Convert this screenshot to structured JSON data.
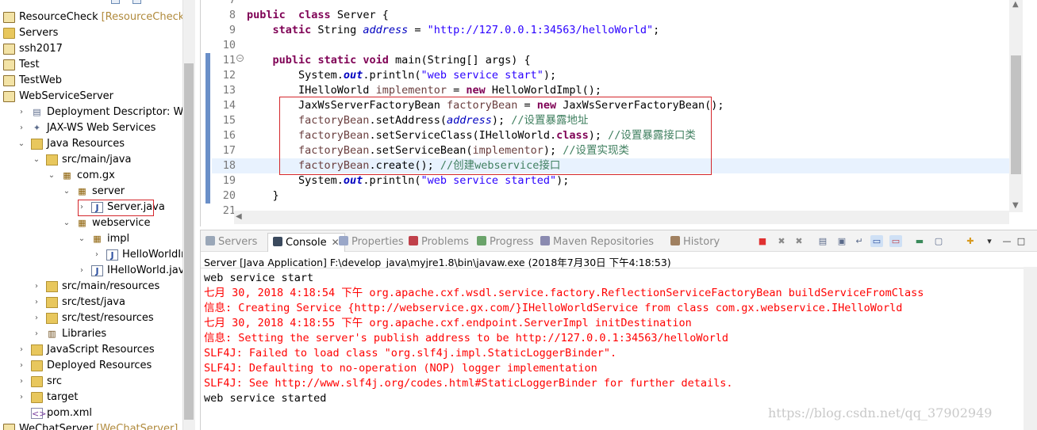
{
  "explorer": {
    "items": [
      {
        "label": "ResourceCheck",
        "deco": "[ResourceCheck]",
        "icon": "project-icon",
        "arrow": "",
        "level": 0
      },
      {
        "label": "Servers",
        "deco": "",
        "icon": "folder-icon",
        "arrow": "",
        "level": 0
      },
      {
        "label": "ssh2017",
        "deco": "",
        "icon": "project-icon",
        "arrow": "",
        "level": 0
      },
      {
        "label": "Test",
        "deco": "",
        "icon": "project-icon",
        "arrow": "",
        "level": 0
      },
      {
        "label": "TestWeb",
        "deco": "",
        "icon": "project-icon",
        "arrow": "",
        "level": 0
      },
      {
        "label": "WebServiceServer",
        "deco": "",
        "icon": "project-icon",
        "arrow": "",
        "level": 0
      },
      {
        "label": "Deployment Descriptor: WebSer",
        "deco": "",
        "icon": "descriptor-icon",
        "arrow": "›",
        "level": 1
      },
      {
        "label": "JAX-WS Web Services",
        "deco": "",
        "icon": "webservice-icon",
        "arrow": "›",
        "level": 1
      },
      {
        "label": "Java Resources",
        "deco": "",
        "icon": "java-resources-icon",
        "arrow": "⌄",
        "level": 1
      },
      {
        "label": "src/main/java",
        "deco": "",
        "icon": "source-folder-icon",
        "arrow": "⌄",
        "level": 2
      },
      {
        "label": "com.gx",
        "deco": "",
        "icon": "package-icon",
        "arrow": "⌄",
        "level": 3
      },
      {
        "label": "server",
        "deco": "",
        "icon": "package-icon",
        "arrow": "⌄",
        "level": 4
      },
      {
        "label": "Server.java",
        "deco": "",
        "icon": "java-file-icon",
        "arrow": "›",
        "level": 5
      },
      {
        "label": "webservice",
        "deco": "",
        "icon": "package-icon",
        "arrow": "⌄",
        "level": 4
      },
      {
        "label": "impl",
        "deco": "",
        "icon": "package-icon",
        "arrow": "⌄",
        "level": 5
      },
      {
        "label": "HelloWorldImp",
        "deco": "",
        "icon": "java-file-icon",
        "arrow": "›",
        "level": 6
      },
      {
        "label": "IHelloWorld.java",
        "deco": "",
        "icon": "java-file-icon",
        "arrow": "›",
        "level": 5
      },
      {
        "label": "src/main/resources",
        "deco": "",
        "icon": "source-folder-icon",
        "arrow": "›",
        "level": 2
      },
      {
        "label": "src/test/java",
        "deco": "",
        "icon": "source-folder-icon",
        "arrow": "›",
        "level": 2
      },
      {
        "label": "src/test/resources",
        "deco": "",
        "icon": "source-folder-icon",
        "arrow": "›",
        "level": 2
      },
      {
        "label": "Libraries",
        "deco": "",
        "icon": "library-icon",
        "arrow": "›",
        "level": 2
      },
      {
        "label": "JavaScript Resources",
        "deco": "",
        "icon": "javascript-icon",
        "arrow": "›",
        "level": 1
      },
      {
        "label": "Deployed Resources",
        "deco": "",
        "icon": "folder-icon",
        "arrow": "›",
        "level": 1
      },
      {
        "label": "src",
        "deco": "",
        "icon": "folder-icon",
        "arrow": "›",
        "level": 1
      },
      {
        "label": "target",
        "deco": "",
        "icon": "folder-icon",
        "arrow": "›",
        "level": 1
      },
      {
        "label": "pom.xml",
        "deco": "",
        "icon": "xml-file-icon",
        "arrow": "",
        "level": 1
      },
      {
        "label": "WeChatServer",
        "deco": "[WeChatServer]",
        "icon": "project-icon",
        "arrow": "",
        "level": 0
      }
    ]
  },
  "editor": {
    "lines": [
      {
        "n": "7",
        "tokens": []
      },
      {
        "n": "8",
        "tokens": [
          [
            "kw",
            "public"
          ],
          [
            "",
            "  "
          ],
          [
            "kw",
            "class"
          ],
          [
            "",
            " Server {"
          ]
        ]
      },
      {
        "n": "9",
        "tokens": [
          [
            "",
            "    "
          ],
          [
            "kw",
            "static"
          ],
          [
            "",
            " String "
          ],
          [
            "fld",
            "address"
          ],
          [
            "",
            " = "
          ],
          [
            "str",
            "\"http://127.0.0.1:34563/helloWorld\""
          ],
          [
            "",
            ";"
          ]
        ]
      },
      {
        "n": "10",
        "tokens": []
      },
      {
        "n": "11",
        "tokens": [
          [
            "",
            "    "
          ],
          [
            "kw",
            "public"
          ],
          [
            "",
            " "
          ],
          [
            "kw",
            "static"
          ],
          [
            "",
            " "
          ],
          [
            "kw",
            "void"
          ],
          [
            "",
            " main(String[] args) {"
          ]
        ]
      },
      {
        "n": "12",
        "tokens": [
          [
            "",
            "        System."
          ],
          [
            "sfld",
            "out"
          ],
          [
            "",
            ".println("
          ],
          [
            "str",
            "\"web service start\""
          ],
          [
            "",
            ");"
          ]
        ]
      },
      {
        "n": "13",
        "tokens": [
          [
            "",
            "        IHelloWorld "
          ],
          [
            "lvar",
            "implementor"
          ],
          [
            "",
            " = "
          ],
          [
            "kw",
            "new"
          ],
          [
            "",
            " HelloWorldImpl();"
          ]
        ]
      },
      {
        "n": "14",
        "tokens": [
          [
            "",
            "        JaxWsServerFactoryBean "
          ],
          [
            "lvar",
            "factoryBean"
          ],
          [
            "",
            " = "
          ],
          [
            "kw",
            "new"
          ],
          [
            "",
            " JaxWsServerFactoryBean();"
          ]
        ]
      },
      {
        "n": "15",
        "tokens": [
          [
            "",
            "        "
          ],
          [
            "lvar",
            "factoryBean"
          ],
          [
            "",
            ".setAddress("
          ],
          [
            "fld",
            "address"
          ],
          [
            "",
            "); "
          ],
          [
            "cmt",
            "//设置暴露地址"
          ]
        ]
      },
      {
        "n": "16",
        "tokens": [
          [
            "",
            "        "
          ],
          [
            "lvar",
            "factoryBean"
          ],
          [
            "",
            ".setServiceClass(IHelloWorld."
          ],
          [
            "kw",
            "class"
          ],
          [
            "",
            "); "
          ],
          [
            "cmt",
            "//设置暴露接口类"
          ]
        ]
      },
      {
        "n": "17",
        "tokens": [
          [
            "",
            "        "
          ],
          [
            "lvar",
            "factoryBean"
          ],
          [
            "",
            ".setServiceBean("
          ],
          [
            "lvar",
            "implementor"
          ],
          [
            "",
            "); "
          ],
          [
            "cmt",
            "//设置实现类"
          ]
        ]
      },
      {
        "n": "18",
        "tokens": [
          [
            "",
            "        "
          ],
          [
            "lvar",
            "factoryBean"
          ],
          [
            "",
            ".create(); "
          ],
          [
            "cmt",
            "//创建webservice接口"
          ]
        ]
      },
      {
        "n": "19",
        "tokens": [
          [
            "",
            "        System."
          ],
          [
            "sfld",
            "out"
          ],
          [
            "",
            ".println("
          ],
          [
            "str",
            "\"web service started\""
          ],
          [
            "",
            ");"
          ]
        ]
      },
      {
        "n": "20",
        "tokens": [
          [
            "",
            "    }"
          ]
        ]
      },
      {
        "n": "21",
        "tokens": []
      }
    ]
  },
  "console": {
    "tabs": [
      {
        "label": "Servers",
        "icon": "servers-icon",
        "active": false
      },
      {
        "label": "Console",
        "icon": "console-icon",
        "active": true,
        "close": "✕"
      },
      {
        "label": "Properties",
        "icon": "properties-icon",
        "active": false
      },
      {
        "label": "Problems",
        "icon": "problems-icon",
        "active": false
      },
      {
        "label": "Progress",
        "icon": "progress-icon",
        "active": false
      },
      {
        "label": "Maven Repositories",
        "icon": "maven-icon",
        "active": false
      },
      {
        "label": "History",
        "icon": "history-icon",
        "active": false
      }
    ],
    "toolbar": [
      "terminate-icon",
      "remove-launch-icon",
      "remove-all-icon",
      "clear-console-icon",
      "scroll-lock-icon",
      "word-wrap-icon",
      "show-stdout-icon",
      "show-stderr-icon",
      "pin-console-icon",
      "display-console-icon",
      "new-console-icon",
      "dropdown-icon",
      "minimize-icon",
      "maximize-icon"
    ],
    "description": "Server [Java Application] F:\\develop_java\\myjre1.8\\bin\\javaw.exe (2018年7月30日 下午4:18:53)",
    "output": [
      {
        "text": "web service start",
        "type": "std"
      },
      {
        "text": "七月 30, 2018 4:18:54 下午 org.apache.cxf.wsdl.service.factory.ReflectionServiceFactoryBean buildServiceFromClass",
        "type": "err"
      },
      {
        "text": "信息: Creating Service {http://webservice.gx.com/}IHelloWorldService from class com.gx.webservice.IHelloWorld",
        "type": "err"
      },
      {
        "text": "七月 30, 2018 4:18:55 下午 org.apache.cxf.endpoint.ServerImpl initDestination",
        "type": "err"
      },
      {
        "text": "信息: Setting the server's publish address to be http://127.0.0.1:34563/helloWorld",
        "type": "err"
      },
      {
        "text": "SLF4J: Failed to load class \"org.slf4j.impl.StaticLoggerBinder\".",
        "type": "err"
      },
      {
        "text": "SLF4J: Defaulting to no-operation (NOP) logger implementation",
        "type": "err"
      },
      {
        "text": "SLF4J: See http://www.slf4j.org/codes.html#StaticLoggerBinder for further details.",
        "type": "err"
      },
      {
        "text": "web service started",
        "type": "std"
      }
    ]
  },
  "watermark": "https://blog.csdn.net/qq_37902949",
  "colors": {
    "keyword": "#7f0055",
    "field": "#0000c0",
    "string": "#2a00ff",
    "comment": "#3f7f5f",
    "error_text": "#ff0000",
    "highlight_box": "#d4262b"
  }
}
